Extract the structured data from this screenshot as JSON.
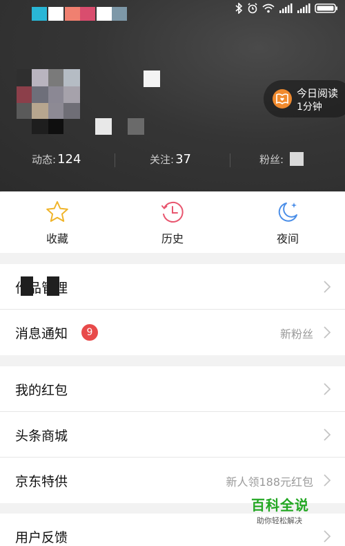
{
  "header": {
    "reading_pill": {
      "title": "今日阅读",
      "subtitle": "1分钟",
      "icon": "book-heart-icon"
    },
    "stats": [
      {
        "label": "动态:",
        "value": "124"
      },
      {
        "label": "关注:",
        "value": "37"
      },
      {
        "label": "粉丝:",
        "value": ""
      }
    ]
  },
  "status_bar": {
    "icons": [
      "bluetooth-icon",
      "alarm-icon",
      "wifi-icon",
      "signal-icon",
      "signal-icon",
      "battery-icon"
    ]
  },
  "quick_actions": [
    {
      "label": "收藏",
      "icon": "star-icon"
    },
    {
      "label": "历史",
      "icon": "clock-icon"
    },
    {
      "label": "夜间",
      "icon": "moon-icon"
    }
  ],
  "menu": {
    "group1": [
      {
        "title": "作品管理",
        "extra": ""
      },
      {
        "title": "消息通知",
        "badge": "9",
        "extra": "新粉丝"
      }
    ],
    "group2": [
      {
        "title": "我的红包",
        "extra": ""
      },
      {
        "title": "头条商城",
        "extra": ""
      },
      {
        "title": "京东特供",
        "extra": "新人领188元红包"
      }
    ],
    "group3": [
      {
        "title": "用户反馈",
        "extra": ""
      }
    ]
  },
  "watermark": {
    "title": "百科全说",
    "subtitle": "助你轻松解决"
  },
  "colors": {
    "accent_orange": "#f08a2e",
    "badge_red": "#e84a4a",
    "star": "#f0b429",
    "clock": "#e8556e",
    "moon": "#4a8ee8"
  }
}
